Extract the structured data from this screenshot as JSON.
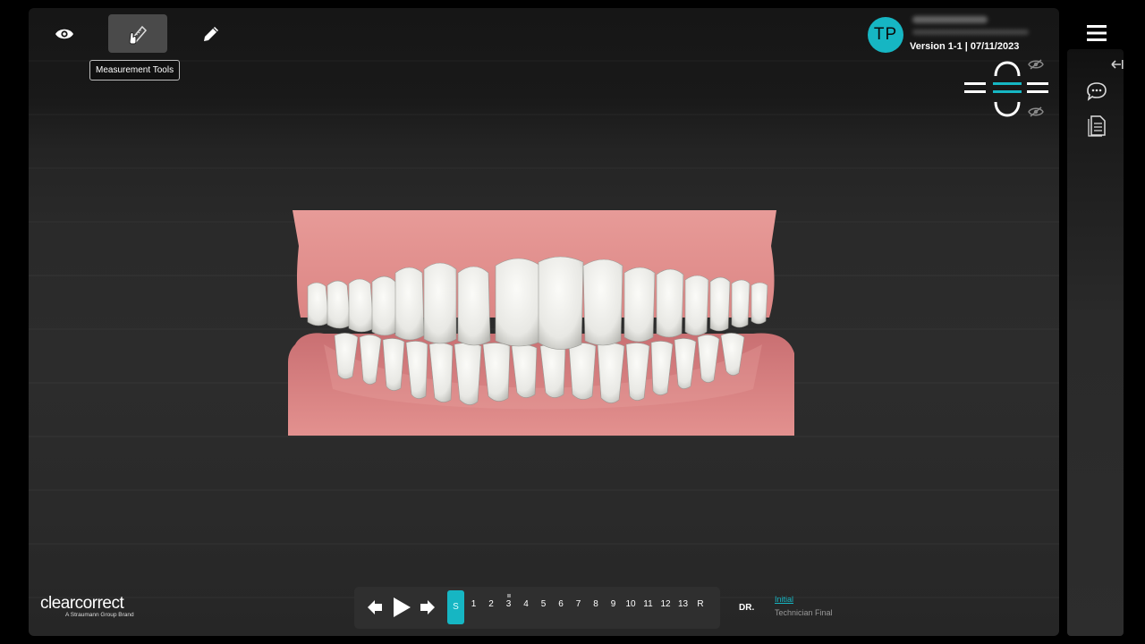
{
  "toolbar": {
    "view_icon": "eye-icon",
    "measure_icon": "measurement-tools-icon",
    "edit_icon": "pencil-icon",
    "tooltip": "Measurement Tools"
  },
  "user": {
    "initials": "TP",
    "version": "Version 1-1 | 07/11/2023"
  },
  "jaw_controls": {
    "upper_icon": "upper-arch-icon",
    "lower_icon": "lower-arch-icon",
    "visibility_icon": "eye-slash-icon"
  },
  "sidebar": {
    "menu_icon": "hamburger-menu-icon",
    "collapse_icon": "collapse-arrow-icon",
    "comments_icon": "comment-icon",
    "document_icon": "document-icon"
  },
  "brand": {
    "name": "clearcorrect",
    "tagline": "A Straumann Group Brand"
  },
  "timeline": {
    "steps": [
      "S",
      "1",
      "2",
      "3",
      "4",
      "5",
      "6",
      "7",
      "8",
      "9",
      "10",
      "11",
      "12",
      "13",
      "R"
    ],
    "active_step": "S",
    "doctor_label": "DR."
  },
  "stage_links": {
    "initial": "Initial",
    "technician_final": "Technician Final"
  },
  "colors": {
    "accent": "#16b6c3",
    "gum": "#e2898a",
    "tooth": "#eeeeea"
  }
}
